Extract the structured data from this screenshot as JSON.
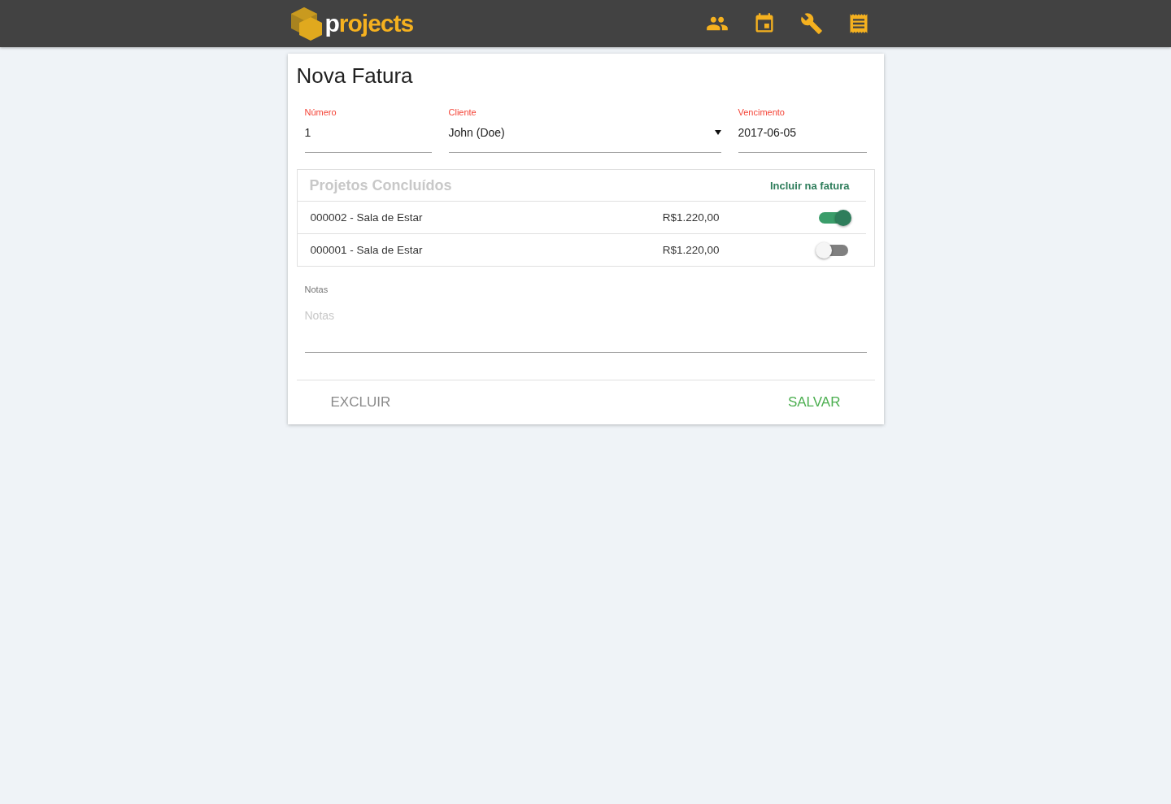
{
  "header": {
    "logo": "projects",
    "nav": [
      {
        "kind": "people"
      },
      {
        "kind": "calendar"
      },
      {
        "kind": "wrench"
      },
      {
        "kind": "receipt"
      }
    ]
  },
  "form": {
    "title": "Nova Fatura",
    "fields": [
      {
        "kind": "text",
        "label": "Número",
        "value": "1"
      },
      {
        "kind": "select",
        "label": "Cliente",
        "value": "John (Doe)"
      },
      {
        "kind": "text",
        "label": "Vencimento",
        "value": "2017-06-05"
      }
    ],
    "projects": {
      "title": "Projetos Concluídos",
      "include_label": "Incluir na fatura",
      "rows": [
        {
          "name": "000002 - Sala de Estar",
          "amount": "R$1.220,00",
          "on": true
        },
        {
          "name": "000001 - Sala de Estar",
          "amount": "R$1.220,00",
          "on": false
        }
      ]
    },
    "notes": {
      "label": "Notas",
      "placeholder": "Notas"
    },
    "buttons": [
      {
        "kind": "delete",
        "label": "EXCLUIR"
      },
      {
        "kind": "save",
        "label": "SALVAR"
      }
    ]
  }
}
